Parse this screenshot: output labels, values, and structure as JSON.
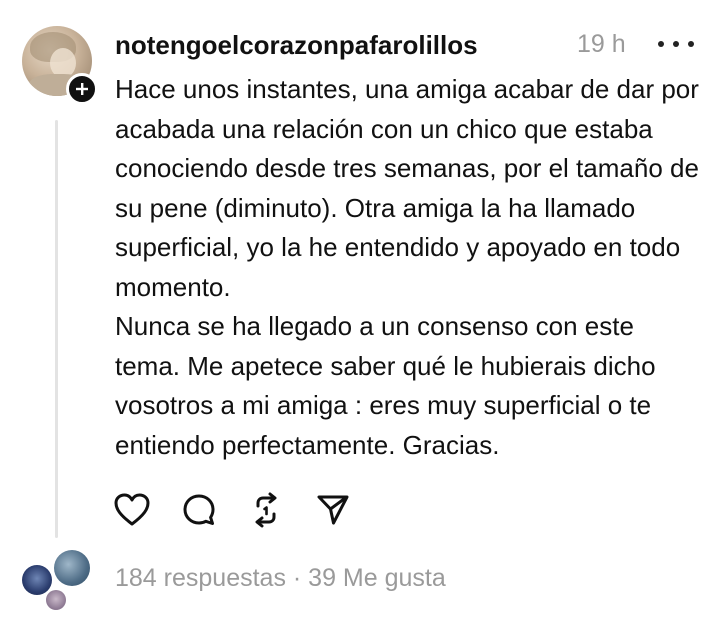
{
  "post": {
    "username": "notengoelcorazonpafarolillos",
    "timestamp": "19 h",
    "paragraphs": [
      "Hace unos instantes, una amiga acabar de dar por acabada una relación con un chico que estaba conociendo desde tres semanas, por el tamaño de su pene (diminuto). Otra amiga la ha llamado superficial, yo la he entendido y apoyado en todo momento.",
      "Nunca se ha llegado a un consenso con este tema. Me apetece saber qué le hubierais dicho vosotros a mi amiga : eres muy superficial o te entiendo perfectamente. Gracias."
    ]
  },
  "actions": {
    "icons": [
      "heart-icon",
      "comment-icon",
      "repost-icon",
      "share-icon"
    ]
  },
  "stats": {
    "text": "184 respuestas · 39 Me gusta"
  },
  "colors": {
    "text": "#111111",
    "muted": "#9a9a9a",
    "thread_line": "#e3e3e3"
  }
}
